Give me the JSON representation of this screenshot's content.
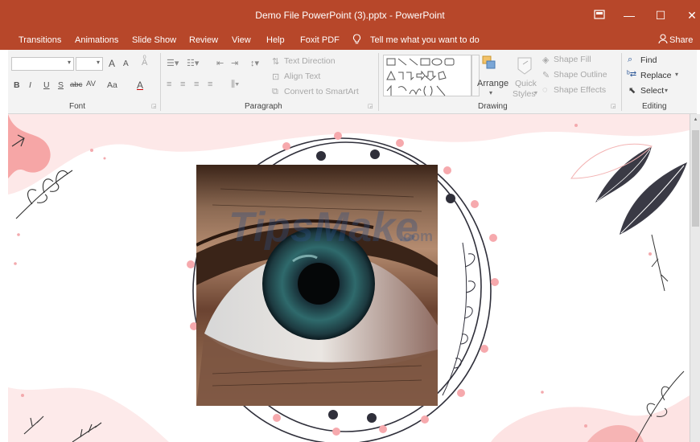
{
  "window": {
    "title": "Demo File PowerPoint (3).pptx  -  PowerPoint",
    "minimize_glyph": "—",
    "maximize_glyph": "☐",
    "close_glyph": "✕"
  },
  "tabs": [
    "Transitions",
    "Animations",
    "Slide Show",
    "Review",
    "View",
    "Help",
    "Foxit PDF"
  ],
  "tell_me": "Tell me what you want to do",
  "share": "Share",
  "ribbon": {
    "font": {
      "label": "Font",
      "bold": "B",
      "italic": "I",
      "underline": "U",
      "strike": "S",
      "abc": "abc",
      "spacing": "AV",
      "case": "Aa",
      "color": "A",
      "grow": "A",
      "shrink": "A"
    },
    "paragraph": {
      "label": "Paragraph",
      "text_direction": "Text Direction",
      "align_text": "Align Text",
      "convert_smartart": "Convert to SmartArt"
    },
    "drawing": {
      "label": "Drawing",
      "arrange": "Arrange",
      "quick_styles_1": "Quick",
      "quick_styles_2": "Styles",
      "shape_fill": "Shape Fill",
      "shape_outline": "Shape Outline",
      "shape_effects": "Shape Effects"
    },
    "editing": {
      "label": "Editing",
      "find": "Find",
      "replace": "Replace",
      "select": "Select"
    }
  },
  "slide": {
    "watermark": "TipsMake",
    "watermark_suffix": ".com"
  },
  "icons": [
    "restore-icon",
    "user-icon",
    "lightbulb-icon",
    "find-icon",
    "replace-icon",
    "select-cursor-icon"
  ]
}
